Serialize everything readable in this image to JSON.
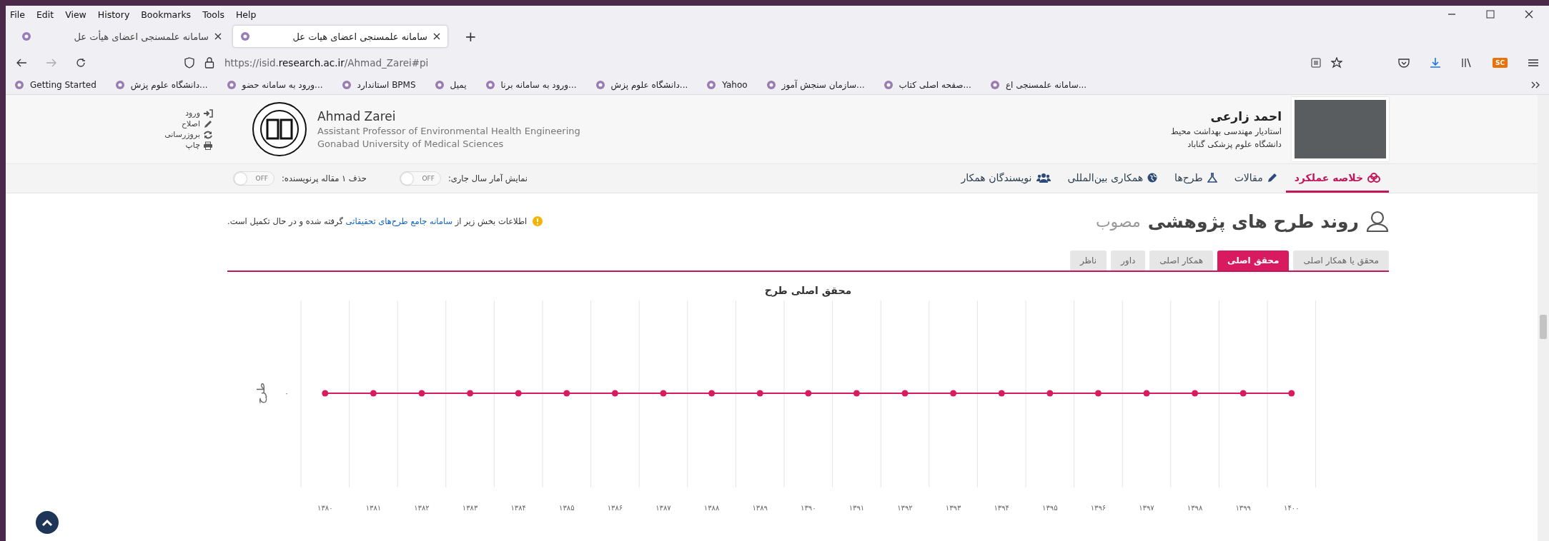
{
  "browser": {
    "menu": [
      "Help",
      "Tools",
      "Bookmarks",
      "History",
      "View",
      "Edit",
      "File"
    ],
    "tabs": [
      {
        "title": "سامانه علمسنجی اعضای هیات عل",
        "selected": true
      },
      {
        "title": "سامانه علمسنجی اعضای هیأت عل",
        "selected": false
      }
    ],
    "new_tab": "+",
    "url": "https://isid.**research.ac.ir**/Ahmad_Zarei#pi",
    "extension_badge": "SC",
    "bookmarks": [
      {
        "label": "سامانه علمسنجی اع..."
      },
      {
        "label": "صفحه اصلی کتاب..."
      },
      {
        "label": "سازمان سنجش آموز..."
      },
      {
        "label": "Yahoo"
      },
      {
        "label": "دانشگاه علوم پزش..."
      },
      {
        "label": "ورود به سامانه برنا..."
      },
      {
        "label": "یمیل"
      },
      {
        "label": "استاندارد BPMS"
      },
      {
        "label": "ورود به سامانه حضو..."
      },
      {
        "label": "دانشگاه علوم پزش..."
      },
      {
        "label": "Getting Started"
      }
    ]
  },
  "profile": {
    "name_fa": "احمد زارعی",
    "title_fa": "استادیار مهندسی بهداشت محیط",
    "university_fa": "دانشگاه علوم پزشکی گناباد",
    "name_en": "Ahmad Zarei",
    "title_en": "Assistant Professor of Environmental Health Engineering",
    "university_en": "Gonabad University of Medical Sciences",
    "links": [
      {
        "kind": "login",
        "label": "ورود"
      },
      {
        "kind": "edit",
        "label": "اصلاح"
      },
      {
        "kind": "refresh",
        "label": "بروزرسانی"
      },
      {
        "kind": "print",
        "label": "چاپ"
      }
    ]
  },
  "nav": {
    "tabs": [
      {
        "kind": "summary",
        "label": "خلاصه عملکرد",
        "selected": true
      },
      {
        "kind": "articles",
        "label": "مقالات",
        "selected": false
      },
      {
        "kind": "projects",
        "label": "طرح‌ها",
        "selected": false
      },
      {
        "kind": "international",
        "label": "همکاری بین‌المللی",
        "selected": false
      },
      {
        "kind": "coauthors",
        "label": "نویسندگان همکار",
        "selected": false
      }
    ],
    "toggles": [
      {
        "label": "نمایش آمار سال جاری:",
        "state_text": "OFF",
        "on": false
      },
      {
        "label": "حذف ۱ مقاله پرنویسنده:",
        "state_text": "OFF",
        "on": false
      }
    ]
  },
  "section": {
    "title": "روند طرح های پژوهشی",
    "title_suffix": "مصوب",
    "notice": {
      "before": "اطلاعات بخش زیر از",
      "link": "سامانه جامع طرح‌های تحقیقاتی",
      "after": "گرفته شده و در حال تکمیل است."
    },
    "role_tabs": [
      {
        "label": "محقق یا همکار اصلی",
        "selected": false
      },
      {
        "label": "محقق اصلی",
        "selected": true
      },
      {
        "label": "همکار اصلی",
        "selected": false
      },
      {
        "label": "داور",
        "selected": false
      },
      {
        "label": "ناظر",
        "selected": false
      }
    ],
    "chart": {
      "title": "محقق اصلی طرح",
      "y_axis_label": "طرح",
      "x_axis_labels": [
        "۱۴۰۰",
        "۱۳۹۹",
        "۱۳۹۸",
        "۱۳۹۷",
        "۱۳۹۶",
        "۱۳۹۵",
        "۱۳۹۴",
        "۱۳۹۳",
        "۱۳۹۲",
        "۱۳۹۱",
        "۱۳۹۰",
        "۱۳۸۹",
        "۱۳۸۸",
        "۱۳۸۷",
        "۱۳۸۶",
        "۱۳۸۵",
        "۱۳۸۴",
        "۱۳۸۳",
        "۱۳۸۲",
        "۱۳۸۱",
        "۱۳۸۰"
      ],
      "y_tick_label": "۰"
    }
  }
}
